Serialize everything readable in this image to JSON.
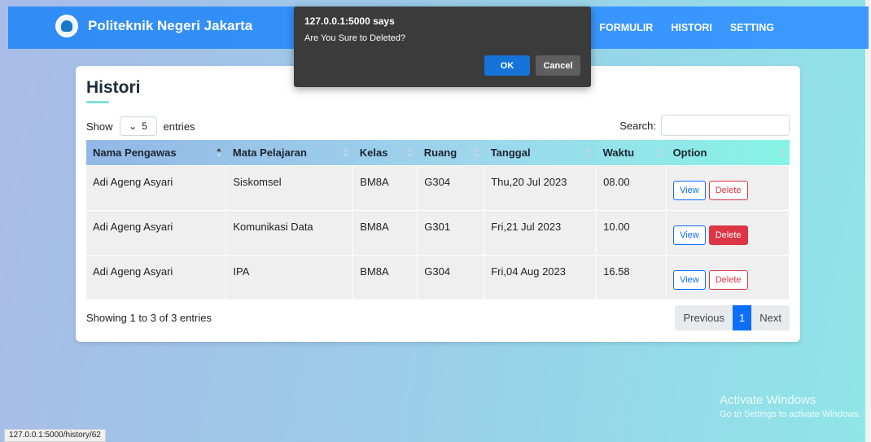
{
  "navbar": {
    "brand": "Politeknik Negeri Jakarta",
    "links": [
      "FORMULIR",
      "HISTORI",
      "SETTING"
    ]
  },
  "card": {
    "title": "Histori",
    "show_label": "Show",
    "entries_value": "5",
    "entries_label": "entries",
    "search_label": "Search:",
    "search_value": ""
  },
  "table": {
    "headers": [
      "Nama Pengawas",
      "Mata Pelajaran",
      "Kelas",
      "Ruang",
      "Tanggal",
      "Waktu",
      "Option"
    ],
    "rows": [
      {
        "nama": "Adi Ageng Asyari",
        "mapel": "Siskomsel",
        "kelas": "BM8A",
        "ruang": "G304",
        "tanggal": "Thu,20 Jul 2023",
        "waktu": "08.00",
        "view": "View",
        "delete": "Delete"
      },
      {
        "nama": "Adi Ageng Asyari",
        "mapel": "Komunikasi Data",
        "kelas": "BM8A",
        "ruang": "G301",
        "tanggal": "Fri,21 Jul 2023",
        "waktu": "10.00",
        "view": "View",
        "delete": "Delete"
      },
      {
        "nama": "Adi Ageng Asyari",
        "mapel": "IPA",
        "kelas": "BM8A",
        "ruang": "G304",
        "tanggal": "Fri,04 Aug 2023",
        "waktu": "16.58",
        "view": "View",
        "delete": "Delete"
      }
    ]
  },
  "footer": {
    "showing": "Showing 1 to 3 of 3 entries",
    "previous": "Previous",
    "page": "1",
    "next": "Next"
  },
  "dialog": {
    "title": "127.0.0.1:5000 says",
    "message": "Are You Sure to Deleted?",
    "ok": "OK",
    "cancel": "Cancel"
  },
  "watermark": {
    "title": "Activate Windows",
    "subtitle": "Go to Settings to activate Windows."
  },
  "statusbar": "127.0.0.1:5000/history/62",
  "colors": {
    "primary": "#0d6efd",
    "danger": "#dc3545",
    "navbar": "#3b99ff"
  }
}
